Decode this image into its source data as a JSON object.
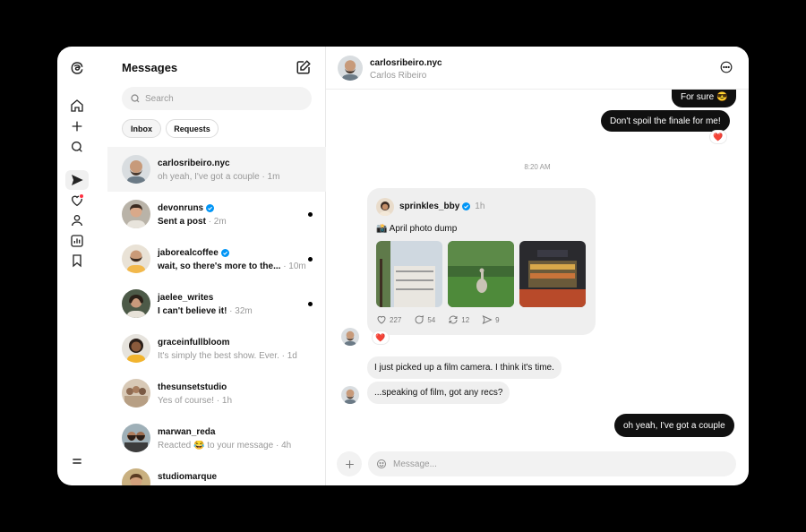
{
  "rail": {
    "icons": [
      "threads-logo-icon",
      "home-icon",
      "plus-icon",
      "search-icon",
      "send-icon",
      "heart-icon",
      "profile-icon",
      "insights-icon",
      "bookmark-icon",
      "menu-icon"
    ]
  },
  "list": {
    "title": "Messages",
    "search_placeholder": "Search",
    "tabs": [
      {
        "label": "Inbox"
      },
      {
        "label": "Requests"
      }
    ],
    "conversations": [
      {
        "name": "carlosribeiro.nyc",
        "preview": "oh yeah, I've got a couple",
        "time": " · 1m",
        "verified": false,
        "unread": false
      },
      {
        "name": "devonruns",
        "preview": "Sent a post",
        "time": " · 2m",
        "verified": true,
        "unread": true
      },
      {
        "name": "jaborealcoffee",
        "preview": "wait, so there's more to the...",
        "time": " · 10m",
        "verified": true,
        "unread": true
      },
      {
        "name": "jaelee_writes",
        "preview": "I can't believe it!",
        "time": " · 32m",
        "verified": false,
        "unread": true
      },
      {
        "name": "graceinfullbloom",
        "preview": "It's simply the best show. Ever.",
        "time": " · 1d",
        "verified": false,
        "unread": false
      },
      {
        "name": "thesunsetstudio",
        "preview": "Yes of course!",
        "time": " · 1h",
        "verified": false,
        "unread": false
      },
      {
        "name": "marwan_reda",
        "preview": "Reacted 😂 to your message",
        "time": " · 4h",
        "verified": false,
        "unread": false
      },
      {
        "name": "studiomarque",
        "preview": "",
        "time": "",
        "verified": false,
        "unread": false
      }
    ]
  },
  "chat": {
    "username": "carlosribeiro.nyc",
    "full_name": "Carlos Ribeiro",
    "messages": {
      "out1": "For sure 😎",
      "out2": "Don't spoil the finale for me!",
      "reaction": "❤️",
      "timestamp": "8:20 AM",
      "shared_user": "sprinkles_bby",
      "shared_time": "1h",
      "shared_text": "📸 April photo dump",
      "likes": "227",
      "comments": "54",
      "reposts": "12",
      "shares": "9",
      "in1": "I just picked up a film camera. I think it's time.",
      "in2": "...speaking of film, got any recs?",
      "out3": "oh yeah, I've got a couple"
    },
    "composer_placeholder": "Message..."
  }
}
